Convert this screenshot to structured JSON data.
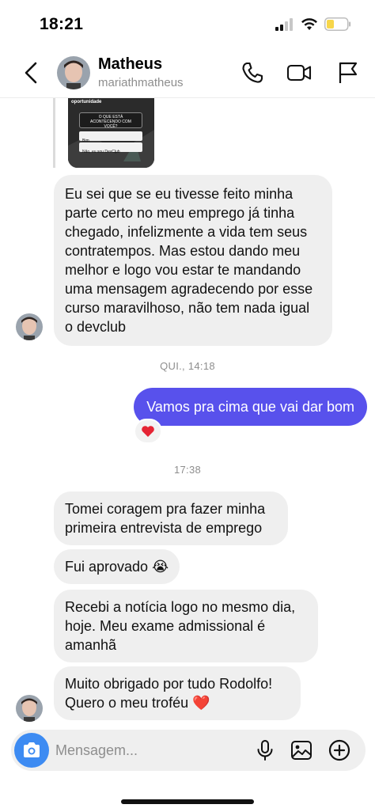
{
  "status_bar": {
    "time": "18:21"
  },
  "header": {
    "contact_name": "Matheus",
    "contact_handle": "mariathmatheus"
  },
  "story_reply": {
    "tag": "oportunidade",
    "question": "O QUE ESTÁ ACONTECENDO COM VOCÊ?",
    "option_1": "Bim",
    "option_2": "Não, eu sou DevClub"
  },
  "messages": {
    "m1": "Eu sei que se eu tivesse feito minha parte certo no meu emprego já tinha chegado, infelizmente a vida tem seus contratempos. Mas estou dando meu melhor e logo vou estar te mandando uma mensagem agradecendo por esse curso maravilhoso, não tem nada igual o devclub",
    "ts1": "QUI., 14:18",
    "m2": "Vamos pra cima que vai dar bom",
    "ts2": "17:38",
    "m3": "Tomei coragem pra fazer minha primeira entrevista de emprego",
    "m4": "Fui aprovado 😭",
    "m5": "Recebi a notícia logo no mesmo dia, hoje. Meu exame admissional é amanhã",
    "m6": "Muito obrigado por tudo Rodolfo! Quero o meu troféu ❤️"
  },
  "composer": {
    "placeholder": "Mensagem..."
  },
  "colors": {
    "outgoing": "#5851ec",
    "incoming": "#efefef",
    "camera": "#3d8bf2",
    "battery": "#f7d64a"
  }
}
